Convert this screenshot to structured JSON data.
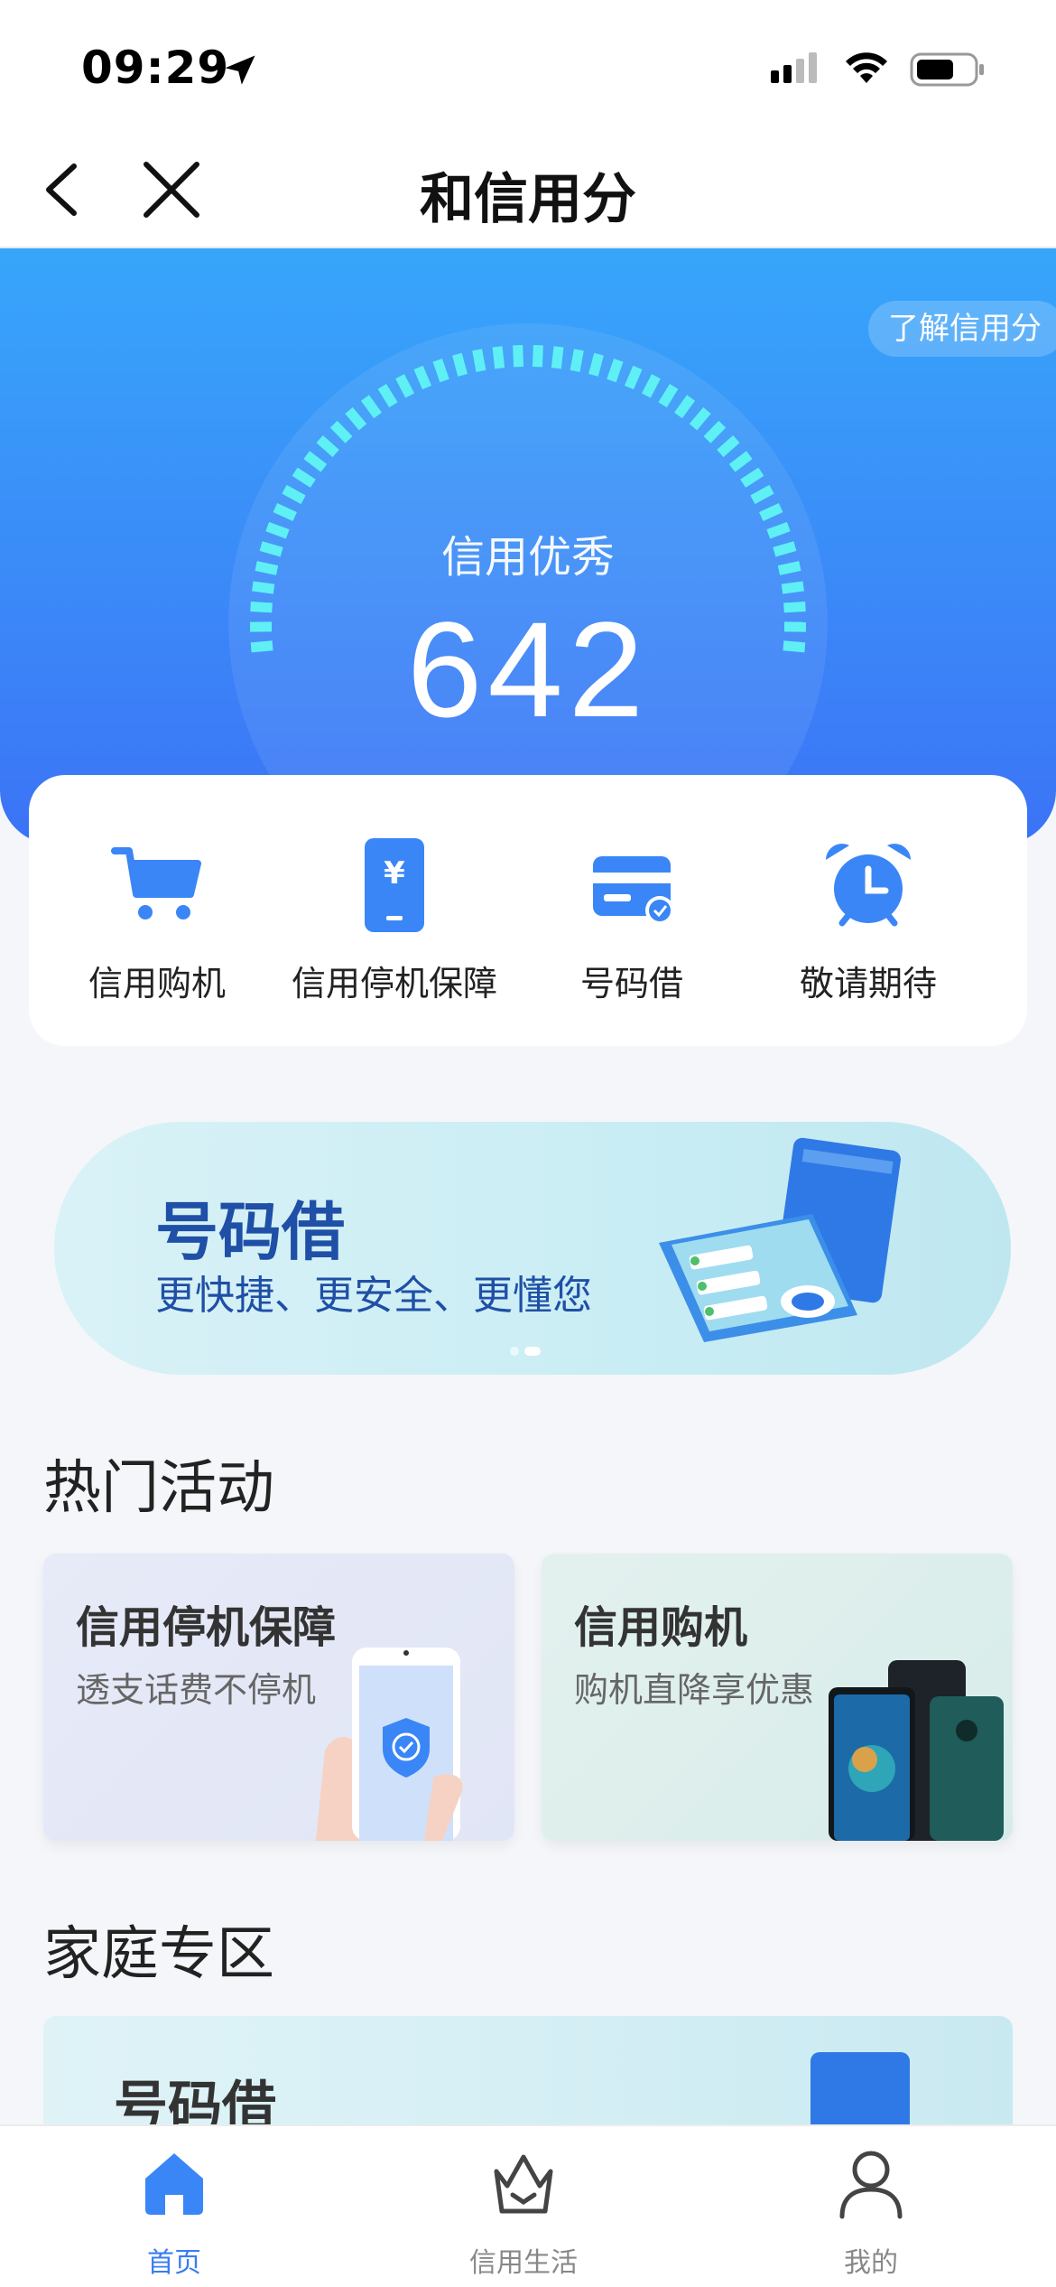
{
  "status_bar": {
    "time": "09:29",
    "icons": [
      "location-arrow-icon",
      "cellular-signal-icon",
      "wifi-icon",
      "battery-icon"
    ]
  },
  "nav": {
    "title": "和信用分",
    "back_icon": "chevron-left-icon",
    "close_icon": "close-icon"
  },
  "hero": {
    "learn_button": "了解信用分",
    "level": "信用优秀",
    "score": "642",
    "colors": {
      "gradient_top": "#37a6fa",
      "gradient_bottom": "#3b73f6",
      "tick": "#5ff0f5"
    }
  },
  "quick_menu": [
    {
      "label": "信用购机",
      "icon": "shopping-cart-icon"
    },
    {
      "label": "信用停机保障",
      "icon": "phone-yuan-icon"
    },
    {
      "label": "号码借",
      "icon": "credit-card-icon"
    },
    {
      "label": "敬请期待",
      "icon": "alarm-clock-icon"
    }
  ],
  "banner": {
    "title": "号码借",
    "subtitle": "更快捷、更安全、更懂您",
    "active_dot": 1,
    "dot_count": 2
  },
  "hot_activities": {
    "title": "热门活动",
    "cards": [
      {
        "title": "信用停机保障",
        "subtitle": "透支话费不停机"
      },
      {
        "title": "信用购机",
        "subtitle": "购机直降享优惠"
      }
    ]
  },
  "family_zone": {
    "title": "家庭专区",
    "card_title": "号码借"
  },
  "tab_bar": {
    "tabs": [
      {
        "label": "首页",
        "icon": "home-icon",
        "active": true
      },
      {
        "label": "信用生活",
        "icon": "crown-basket-icon",
        "active": false
      },
      {
        "label": "我的",
        "icon": "user-icon",
        "active": false
      }
    ],
    "active_color": "#3a7cf3"
  }
}
